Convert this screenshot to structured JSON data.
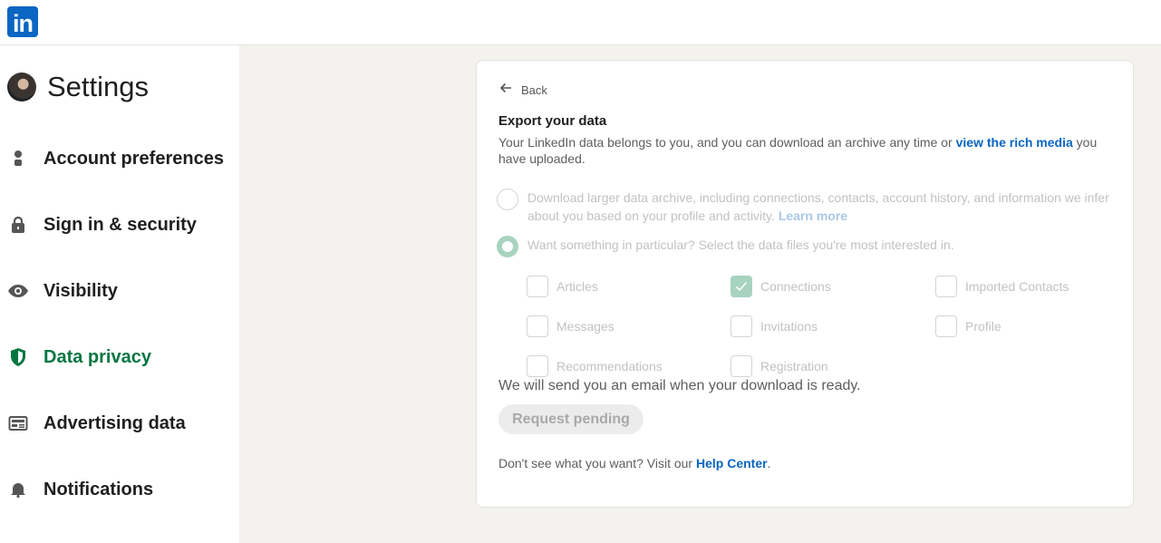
{
  "header": {
    "logo_text": "in"
  },
  "sidebar": {
    "title": "Settings",
    "items": [
      {
        "label": "Account preferences",
        "icon": "person-icon",
        "active": false
      },
      {
        "label": "Sign in & security",
        "icon": "lock-icon",
        "active": false
      },
      {
        "label": "Visibility",
        "icon": "eye-icon",
        "active": false
      },
      {
        "label": "Data privacy",
        "icon": "shield-icon",
        "active": true
      },
      {
        "label": "Advertising data",
        "icon": "newspaper-icon",
        "active": false
      },
      {
        "label": "Notifications",
        "icon": "bell-icon",
        "active": false
      }
    ]
  },
  "main": {
    "back_label": "Back",
    "title": "Export your data",
    "description_pre": "Your LinkedIn data belongs to you, and you can download an archive any time or ",
    "description_link": "view the rich media",
    "description_post": " you have uploaded.",
    "options": [
      {
        "text": "Download larger data archive, including connections, contacts, account history, and information we infer about you based on your profile and activity. ",
        "link": "Learn more",
        "selected": false
      },
      {
        "text": "Want something in particular? Select the data files you're most interested in.",
        "selected": true
      }
    ],
    "checkboxes": [
      {
        "label": "Articles",
        "checked": false
      },
      {
        "label": "Connections",
        "checked": true
      },
      {
        "label": "Imported Contacts",
        "checked": false
      },
      {
        "label": "Messages",
        "checked": false
      },
      {
        "label": "Invitations",
        "checked": false
      },
      {
        "label": "Profile",
        "checked": false
      },
      {
        "label": "Recommendations",
        "checked": false
      },
      {
        "label": "Registration",
        "checked": false
      }
    ],
    "email_note": "We will send you an email when your download is ready.",
    "pending_button": "Request pending",
    "help_pre": "Don't see what you want? Visit our ",
    "help_link": "Help Center",
    "help_post": "."
  },
  "colors": {
    "brand": "#0a66c2",
    "active_nav": "#057642",
    "checked_fill": "#a8d3c0"
  }
}
